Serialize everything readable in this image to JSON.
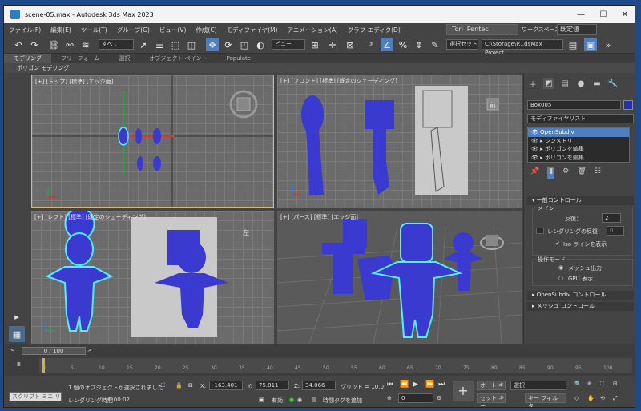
{
  "title": "scene-05.max - Autodesk 3ds Max 2023",
  "menu": [
    "ファイル(F)",
    "編集(E)",
    "ツール(T)",
    "グループ(G)",
    "ビュー(V)",
    "作成(C)",
    "モディファイヤ(M)",
    "アニメーション(A)",
    "グラフ エディタ(D)"
  ],
  "user": "Tori iPentec",
  "workspace_label": "ワークスペース:",
  "workspace": "既定値",
  "toolbar": {
    "filter": "すべて",
    "view": "ビュー",
    "selset": "選択セット",
    "path": "C:\\Storage\\P...dsMax Project"
  },
  "ribbon_tabs": [
    "モデリング",
    "フリーフォーム",
    "選択",
    "オブジェクト ペイント",
    "Populate"
  ],
  "subribbon": "ポリゴン モデリング",
  "viewports": {
    "top": "[+] [トップ] [標準] [エッジ面]",
    "front": "[+] [フロント] [標準] [既定のシェーディング]",
    "left": "[+] [レフト] [標準] [既定のシェーディング]",
    "persp": "[+] [パース] [標準] [エッジ面]"
  },
  "viewcube": {
    "top": "上",
    "front": "前",
    "left": "左"
  },
  "command": {
    "object_name": "Box005",
    "modifier_list": "モディファイヤリスト",
    "stack": [
      "OpenSubdiv",
      "シンメトリ",
      "ポリゴンを編集",
      "ポリゴンを編集"
    ],
    "general": "一般コントロール",
    "main": "メイン",
    "iter_label": "反復：",
    "iter": "2",
    "render_iter_label": "レンダリングの反復：",
    "render_iter": "0",
    "iso_label": "Iso ラインを表示",
    "op_mode": "操作モード",
    "mesh_out": "メッシュ出力",
    "gpu": "GPU 表示",
    "osd": "OpenSubdiv コントロール",
    "mesh": "メッシュ コントロール"
  },
  "timeline": {
    "frame": "0 / 100",
    "ticks": [
      "0",
      "5",
      "10",
      "15",
      "20",
      "25",
      "30",
      "35",
      "40",
      "45",
      "50",
      "55",
      "60",
      "65",
      "70",
      "75",
      "80",
      "85",
      "90",
      "95",
      "100"
    ]
  },
  "status": {
    "sculpt": "スクリプト ミニ リス",
    "msg": "1 個のオブジェクトが選択されました",
    "render_time_label": "レンダリング時間",
    "render_time": "0:00:02",
    "x": "-163.401",
    "y": "75.811",
    "z": "34.066",
    "grid": "グリッド = 10.0",
    "enabled": "有効：",
    "addtag": "時間タグを追加",
    "autokey": "オート キー",
    "setkey": "セット キー",
    "sel": "選択",
    "keyfilter": "キー フィルタ...",
    "frame": "0"
  }
}
